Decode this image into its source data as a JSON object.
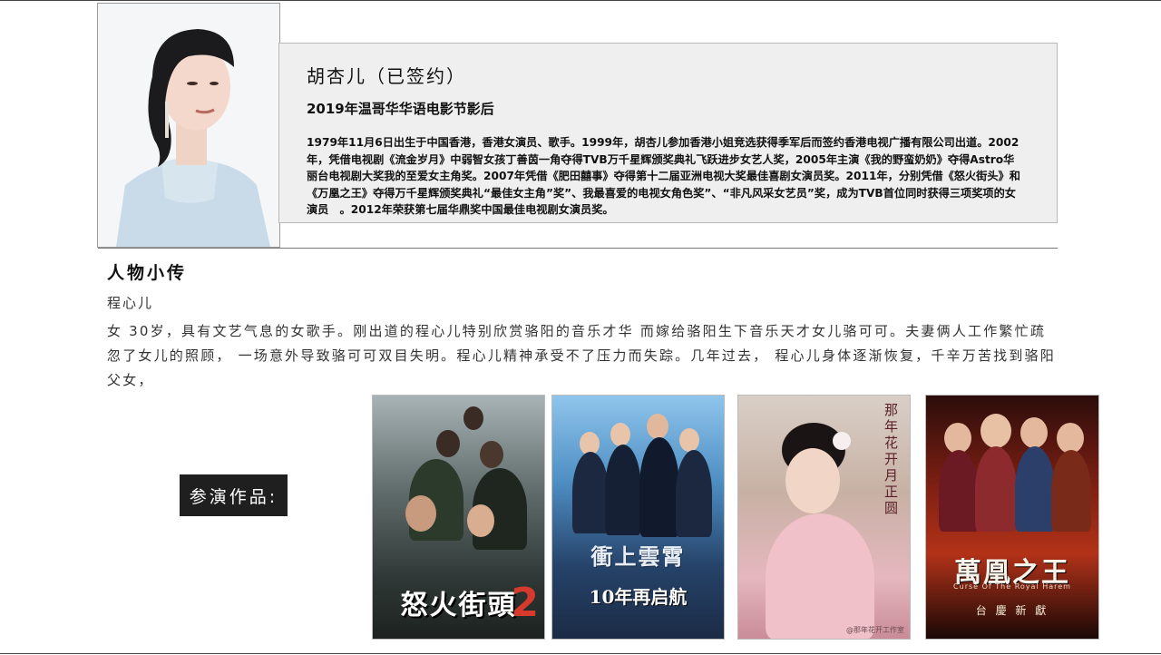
{
  "profile": {
    "name": "胡杏儿（已签约）",
    "award": "2019年温哥华华语电影节影后",
    "bio": "1979年11月6日出生于中国香港，香港女演员、歌手。1999年，胡杏儿参加香港小姐竞选获得季军后而签约香港电视广播有限公司出道。2002年，凭借电视剧《流金岁月》中弱智女孩丁善茵一角夺得TVB万千星辉颁奖典礼飞跃进步女艺人奖，2005年主演《我的野蛮奶奶》夺得Astro华丽台电视剧大奖我的至爱女主角奖。2007年凭借《肥田囍事》夺得第十二届亚洲电视大奖最佳喜剧女演员奖。2011年，分别凭借《怒火街头》和《万凰之王》夺得万千星辉颁奖典礼“最佳女主角”奖”、我最喜爱的电视女角色奖”、“非凡风采女艺员”奖，成为TVB首位同时获得三项奖项的女演员　。2012年荣获第七届华鼎奖中国最佳电视剧女演员奖。"
  },
  "character": {
    "section_title": "人物小传",
    "role_name": "程心儿",
    "description": "女 30岁，具有文艺气息的女歌手。刚出道的程心儿特别欣赏骆阳的音乐才华 而嫁给骆阳生下音乐天才女儿骆可可。夫妻俩人工作繁忙疏忽了女儿的照顾， 一场意外导致骆可可双目失明。程心儿精神承受不了压力而失踪。几年过去， 程心儿身体逐渐恢复，千辛万苦找到骆阳父女，"
  },
  "works": {
    "label": "参演作品:",
    "posters": [
      {
        "title": "怒火街頭",
        "number": "2"
      },
      {
        "title": "衝上雲霄",
        "subtitle": "10年再启航"
      },
      {
        "vertical_text": "那年花开月正圆",
        "credit": "@那年花开工作室"
      },
      {
        "title": "萬凰之王",
        "subtitle": "Curse Of The Royal Harem",
        "tagline": "台 慶 新 獻"
      }
    ]
  },
  "colors": {
    "label_bg": "#1f1f1f",
    "card_bg": "#efefef",
    "accent_red": "#d63a2c"
  }
}
